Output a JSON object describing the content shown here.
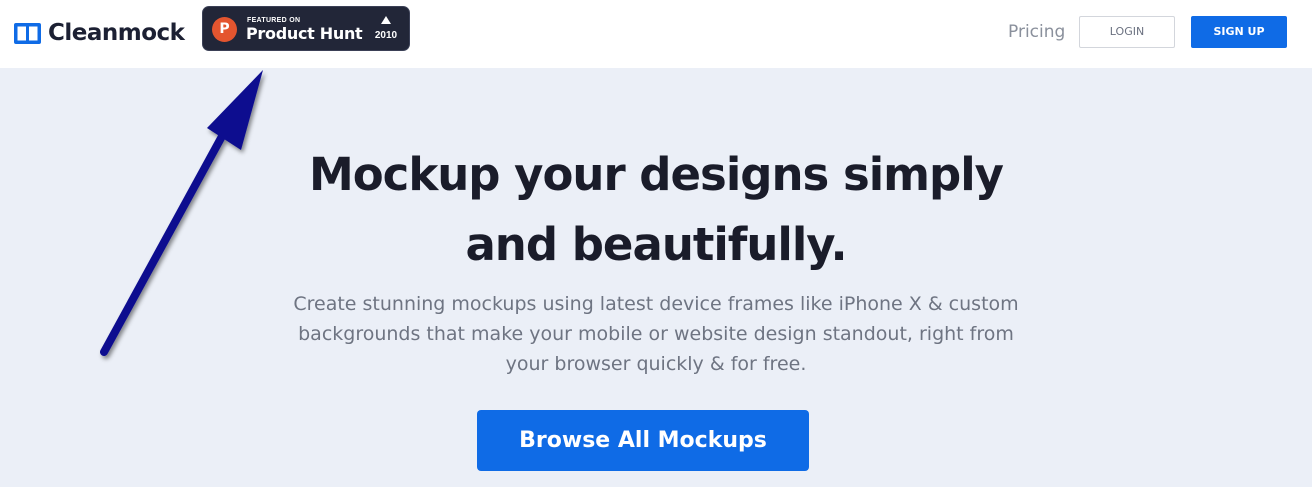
{
  "header": {
    "logo_text": "Cleanmock",
    "product_hunt": {
      "featured_label": "FEATURED ON",
      "name": "Product Hunt",
      "logo_letter": "P",
      "upvote_count": "2010"
    },
    "nav": {
      "pricing_label": "Pricing",
      "login_label": "LOGIN",
      "signup_label": "SIGN UP"
    }
  },
  "hero": {
    "title_line1": "Mockup your designs simply",
    "title_line2": "and beautifully.",
    "subtitle_line1": "Create stunning mockups using latest device frames like iPhone X & custom",
    "subtitle_line2": "backgrounds that make your mobile or website design standout, right from",
    "subtitle_line3": "your browser quickly & for free.",
    "cta_label": "Browse All Mockups"
  },
  "colors": {
    "brand_blue": "#0f6be6",
    "hero_background": "#ebeff7",
    "badge_background": "#222638",
    "product_hunt_orange": "#e4552f",
    "annotation_arrow": "#0b0b8f"
  },
  "icons": {
    "logo": "cleanmock-logo-icon",
    "product_hunt": "product-hunt-logo",
    "upvote": "upvote-triangle-icon",
    "annotation": "annotation-arrow"
  }
}
